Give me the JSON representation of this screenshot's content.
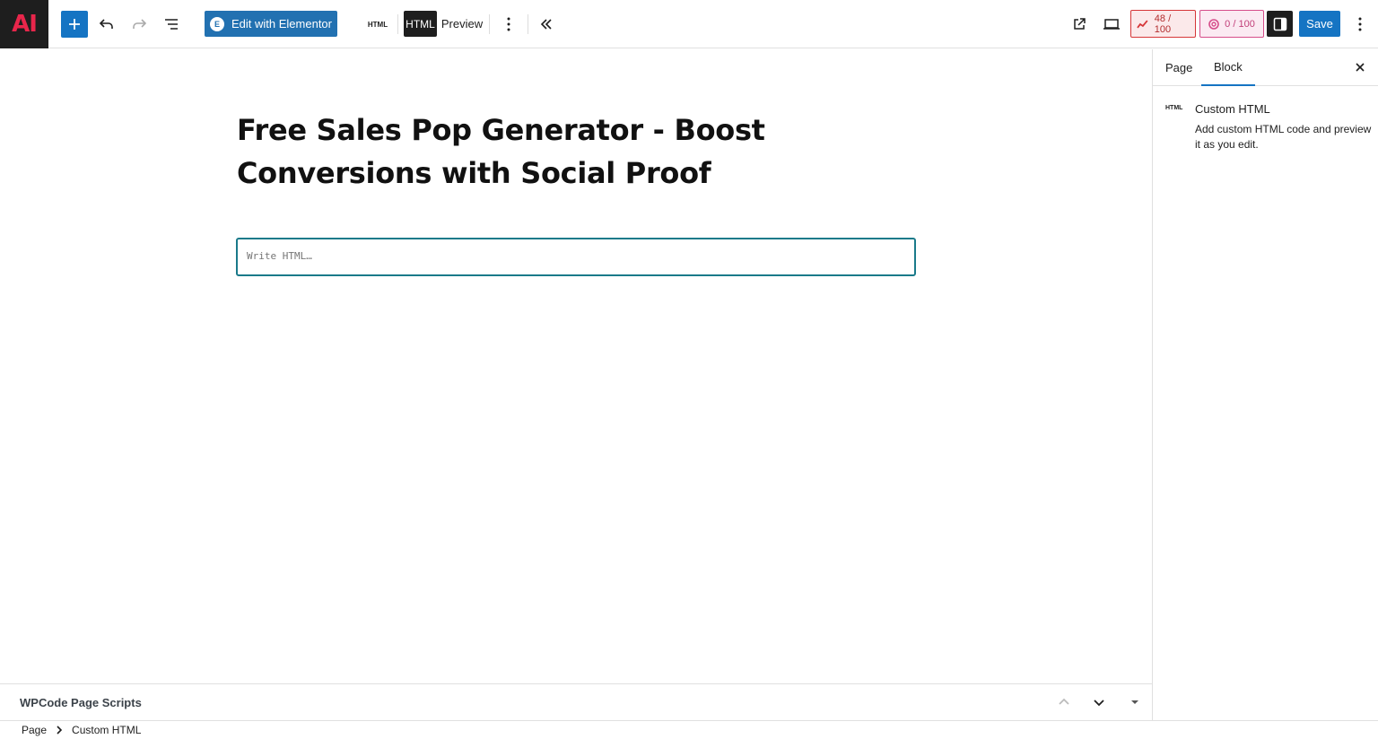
{
  "app": {
    "logo_text": "AI"
  },
  "toolbar": {
    "add_block_label": "+",
    "edit_elementor_label": "Edit with Elementor",
    "elementor_icon_letter": "E",
    "mode_small_label": "HTML",
    "mode_html_label": "HTML",
    "mode_preview_label": "Preview",
    "seo_score": "48 / 100",
    "readability_score": "0 / 100",
    "save_label": "Save"
  },
  "editor": {
    "post_title": "Free Sales Pop Generator - Boost Conversions with Social Proof",
    "html_placeholder": "Write HTML…"
  },
  "sidebar": {
    "tabs": [
      {
        "label": "Page"
      },
      {
        "label": "Block"
      }
    ],
    "active_tab": "Block",
    "block": {
      "icon_label": "HTML",
      "name": "Custom HTML",
      "description": "Add custom HTML code and preview it as you edit."
    }
  },
  "meta_panel": {
    "title": "WPCode Page Scripts"
  },
  "breadcrumb": [
    {
      "label": "Page"
    },
    {
      "label": "Custom HTML"
    }
  ],
  "colors": {
    "accent": "#1574c3",
    "editor_border": "#1a7a8a",
    "seo_red": "#d63638",
    "readability_pink": "#d64d8a"
  }
}
